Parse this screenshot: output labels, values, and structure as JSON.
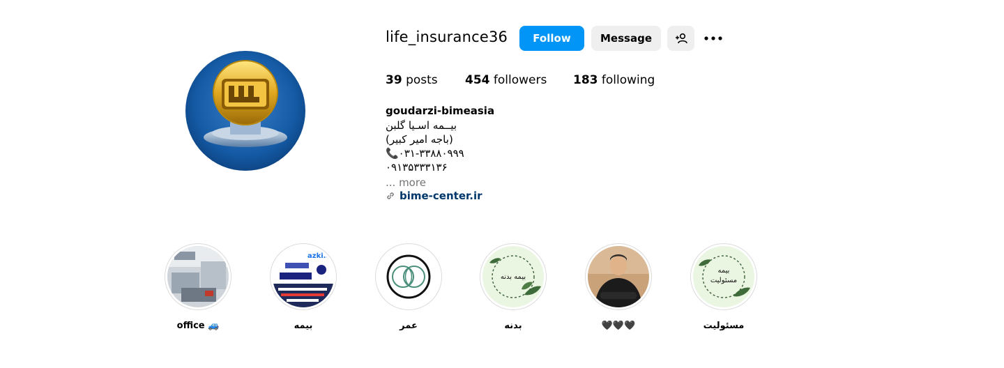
{
  "profile": {
    "username": "life_insurance36",
    "follow_label": "Follow",
    "message_label": "Message",
    "add_user_icon": "person-add-icon",
    "more_icon": "more-options-icon"
  },
  "stats": {
    "posts_count": "39",
    "posts_label": "posts",
    "followers_count": "454",
    "followers_label": "followers",
    "following_count": "183",
    "following_label": "following"
  },
  "bio": {
    "name": "goudarzi-bimeasia",
    "lines": [
      "بیــمه اسـیا گلبن",
      "(باجه امیر کبیر)",
      "📞۰۳۱-۳۳۸۸۰۹۹۹",
      "۰۹۱۳۵۳۳۳۱۳۶"
    ],
    "more": "... more",
    "link": "bime-center.ir",
    "link_icon": "link-icon"
  },
  "highlights": [
    {
      "label": "office 🚙",
      "icon": "office-photo"
    },
    {
      "label": "بیمه",
      "icon": "azki-ad-photo"
    },
    {
      "label": "عمر",
      "icon": "leaf-logo-icon"
    },
    {
      "label": "بدنه",
      "icon": "leaf-wreath-badge",
      "badge_text": "بیمه بدنه"
    },
    {
      "label": "🖤🖤🖤",
      "icon": "man-portrait-photo"
    },
    {
      "label": "مسئولیت",
      "icon": "leaf-wreath-badge",
      "badge_text": "بیمه مسئولیت"
    }
  ],
  "colors": {
    "primary_button": "#0095f6",
    "secondary_button": "#efefef",
    "link": "#00376b",
    "muted": "#737373"
  }
}
